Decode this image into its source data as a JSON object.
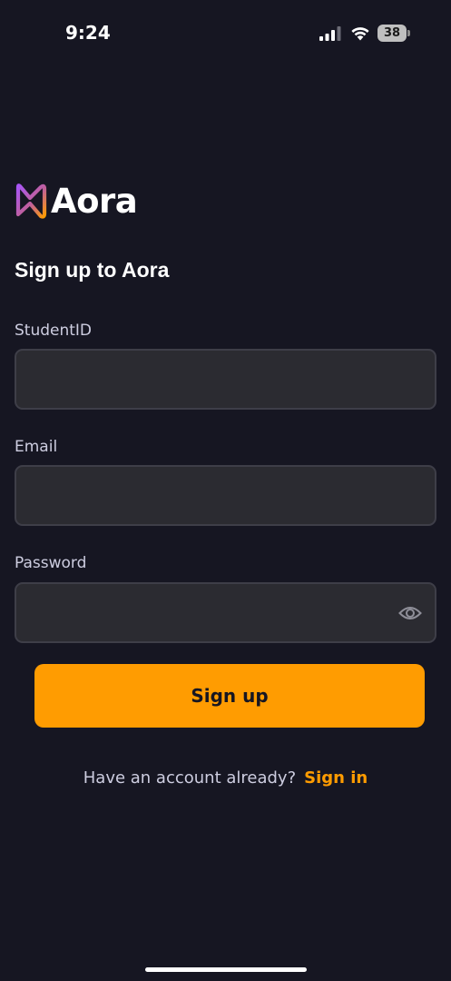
{
  "status_bar": {
    "time": "9:24",
    "battery_level": "38"
  },
  "brand": {
    "name": "Aora",
    "accent_color": "#FF9C01",
    "logo_gradient": [
      "#A855F7",
      "#FF9C01"
    ],
    "background_color": "#161622"
  },
  "title": "Sign up to Aora",
  "form": {
    "student_id": {
      "label": "StudentID",
      "value": ""
    },
    "email": {
      "label": "Email",
      "value": ""
    },
    "password": {
      "label": "Password",
      "value": "",
      "icon": "eye-icon"
    }
  },
  "submit_label": "Sign up",
  "footer": {
    "prompt": "Have an account already?",
    "link_label": "Sign in"
  }
}
